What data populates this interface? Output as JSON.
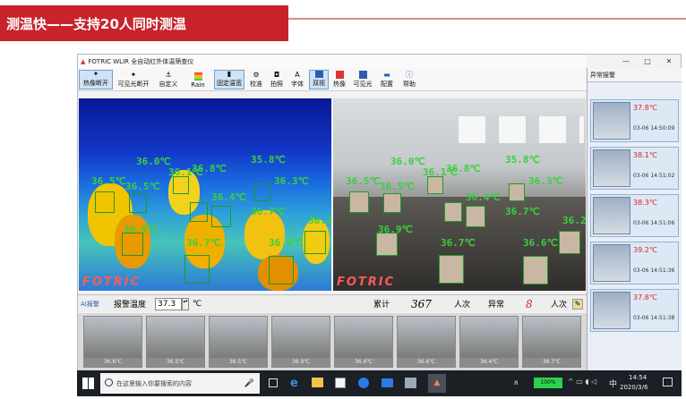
{
  "slide": {
    "title": "测温快——支持20人同时测温"
  },
  "app": {
    "title": "FOTRIC WLIR 全自动红外体温筛查仪",
    "window_controls": [
      "—",
      "□",
      "✕"
    ],
    "toolbar": [
      {
        "label": "热像断开",
        "icon": "thermal-camera-icon",
        "selected": true
      },
      {
        "label": "可见光断开",
        "icon": "visible-camera-icon",
        "selected": false
      },
      {
        "label": "自定义",
        "icon": "custom-icon",
        "selected": false
      },
      {
        "label": "Rain",
        "icon": "palette-icon",
        "selected": false
      },
      {
        "label": "固定温宽",
        "icon": "range-icon",
        "selected": true
      },
      {
        "label": "校准",
        "icon": "gear-icon",
        "selected": false
      },
      {
        "label": "拍照",
        "icon": "camera-icon",
        "selected": false
      },
      {
        "label": "字体",
        "icon": "font-icon",
        "selected": false
      },
      {
        "label": "双视",
        "icon": "dual-view-icon",
        "selected": true
      },
      {
        "label": "热像",
        "icon": "thermal-view-icon",
        "selected": false
      },
      {
        "label": "可见光",
        "icon": "visible-view-icon",
        "selected": false
      },
      {
        "label": "配置",
        "icon": "config-icon",
        "selected": false
      },
      {
        "label": "帮助",
        "icon": "help-icon",
        "selected": false
      }
    ],
    "thermal_brand": "FOTRIC",
    "visible_brand": "FOTRIC",
    "temp_labels": [
      "36.5℃",
      "36.0℃",
      "36.5℃",
      "36.1℃",
      "36.8℃",
      "35.8℃",
      "36.3℃",
      "36.4℃",
      "36.7℃",
      "36.9℃",
      "36.7℃",
      "36.6℃",
      "36.2℃"
    ],
    "status": {
      "ai_label": "AI报警",
      "alarm_temp_label": "报警温度",
      "alarm_temp_value": "37.3",
      "unit": "℃",
      "total_label": "累计",
      "total_value": "367",
      "total_unit": "人次",
      "abnormal_label": "异常",
      "abnormal_value": "8",
      "abnormal_unit": "人次"
    },
    "thumb_temps": [
      "36.6℃",
      "36.5℃",
      "36.5℃",
      "36.9℃",
      "36.4℃",
      "36.6℃",
      "36.4℃",
      "36.7℃"
    ],
    "alerts_title": "异常报警",
    "alerts": [
      {
        "temp": "37.8℃",
        "time": "03-06 14:50:09"
      },
      {
        "temp": "38.1℃",
        "time": "03-06 14:51:02"
      },
      {
        "temp": "38.3℃",
        "time": "03-06 14:51:06"
      },
      {
        "temp": "39.2℃",
        "time": "03-06 14:51:36"
      },
      {
        "temp": "37.8℃",
        "time": "03-06 14:51:38"
      }
    ]
  },
  "taskbar": {
    "search_placeholder": "在这里输入你要搜索的内容",
    "battery": "100%",
    "ime": "中",
    "time": "14:54",
    "date": "2020/3/6"
  }
}
